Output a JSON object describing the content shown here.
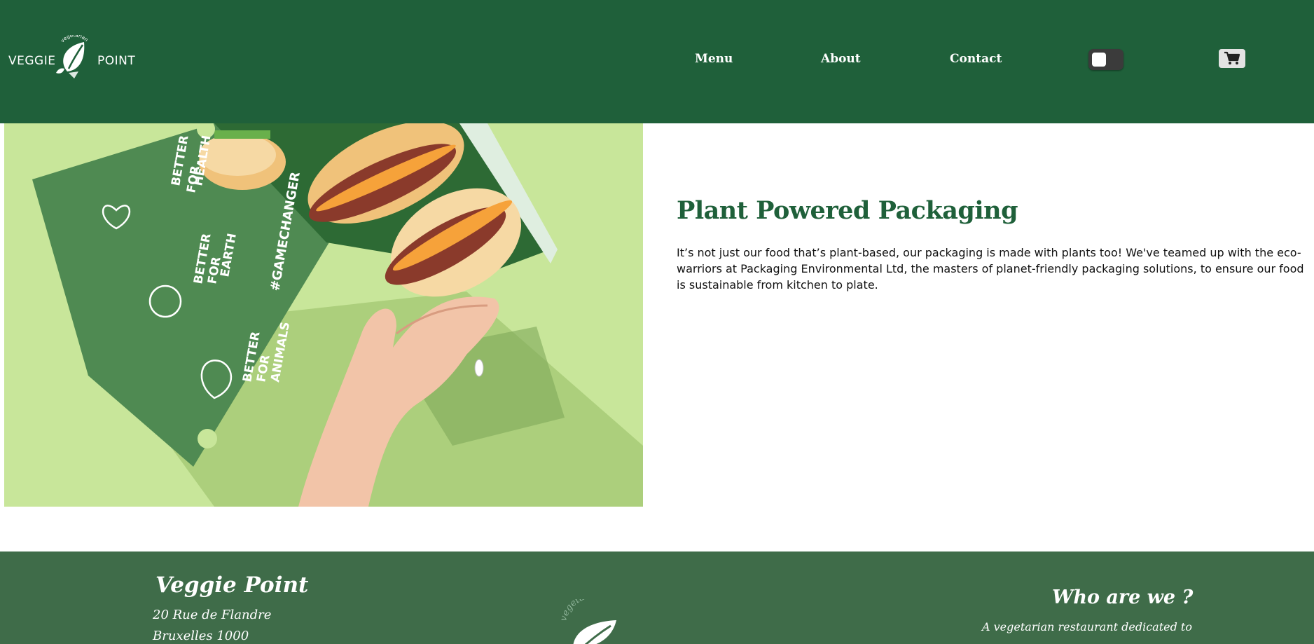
{
  "brand": {
    "name_left": "VEGGIE",
    "name_right": "POINT",
    "badge": "vegetarian"
  },
  "nav": {
    "items": [
      {
        "label": "Menu"
      },
      {
        "label": "About"
      },
      {
        "label": "Contact"
      }
    ]
  },
  "theme_toggle": {
    "icon": "toggle-switch",
    "state": "off"
  },
  "cart": {
    "icon": "cart-icon"
  },
  "hero": {
    "image_alt": "Hand holding green burger box",
    "box_texts": [
      "BETTER FOR HEALTH",
      "BETTER FOR EARTH",
      "BETTER FOR ANIMALS",
      "#GAMECHANGER"
    ]
  },
  "section": {
    "title": "Plant Powered Packaging",
    "description": "It’s not just our food that’s plant-based, our packaging is made with plants too! We've teamed up with the eco-warriors at Packaging Environmental Ltd, the masters of planet-friendly packaging solutions, to ensure our food is sustainable from kitchen to plate."
  },
  "footer": {
    "name": "Veggie Point",
    "address_line1": "20 Rue de Flandre",
    "address_line2": "Bruxelles 1000",
    "logo_badge": "vegetarien",
    "who_title": "Who are we ?",
    "who_text": "A vegetarian restaurant dedicated to"
  },
  "colors": {
    "header_bg": "#1f603a",
    "footer_bg": "#3f6c49",
    "title": "#1f603a",
    "hero_bg": "#c8e69a",
    "box_green": "#4f8a52"
  }
}
